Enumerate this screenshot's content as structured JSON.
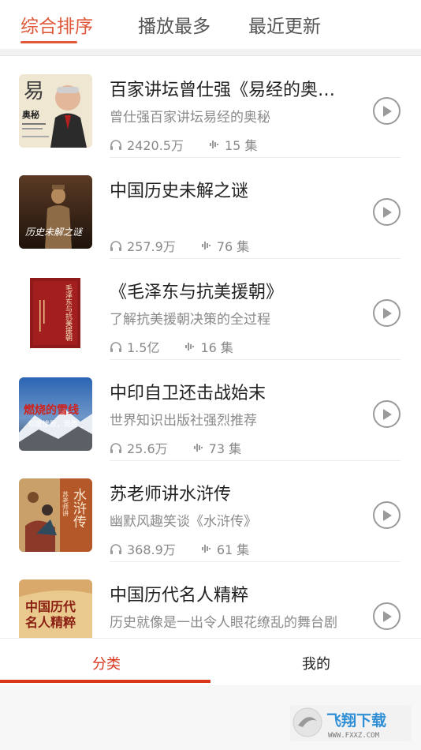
{
  "tabs": [
    {
      "label": "综合排序",
      "active": true
    },
    {
      "label": "播放最多",
      "active": false
    },
    {
      "label": "最近更新",
      "active": false
    }
  ],
  "items": [
    {
      "title": "百家讲坛曾仕强《易经的奥秘》",
      "subtitle": "曾仕强百家讲坛易经的奥秘",
      "plays": "2420.5万",
      "episodes": "15 集"
    },
    {
      "title": "中国历史未解之谜",
      "subtitle": "",
      "plays": "257.9万",
      "episodes": "76 集"
    },
    {
      "title": "《毛泽东与抗美援朝》",
      "subtitle": "了解抗美援朝决策的全过程",
      "plays": "1.5亿",
      "episodes": "16 集"
    },
    {
      "title": "中印自卫还击战始末",
      "subtitle": "世界知识出版社强烈推荐",
      "plays": "25.6万",
      "episodes": "73 集"
    },
    {
      "title": "苏老师讲水浒传",
      "subtitle": "幽默风趣笑谈《水浒传》",
      "plays": "368.9万",
      "episodes": "61 集"
    },
    {
      "title": "中国历代名人精粹",
      "subtitle": "历史就像是一出令人眼花缭乱的舞台剧",
      "plays": "",
      "episodes": ""
    }
  ],
  "covers": {
    "c0_big": "易",
    "c0_small": "奥秘",
    "c1_caption": "历史未解之谜",
    "c2_title": "毛泽东与抗美援朝",
    "c3_title": "燃烧的雪线",
    "c3_sub": "印度惨败，我胜",
    "c4_title": "水浒传",
    "c4_sub": "苏老师讲",
    "c5_line1": "中国历代",
    "c5_line2": "名人精粹"
  },
  "bottom_nav": {
    "category_label": "分类",
    "mine_label": "我的"
  },
  "watermark": {
    "text": "飞翔下载",
    "url_text": "WWW.FXXZ.COM"
  },
  "colors": {
    "accent": "#e0583a",
    "nav_active": "#d9361c"
  }
}
